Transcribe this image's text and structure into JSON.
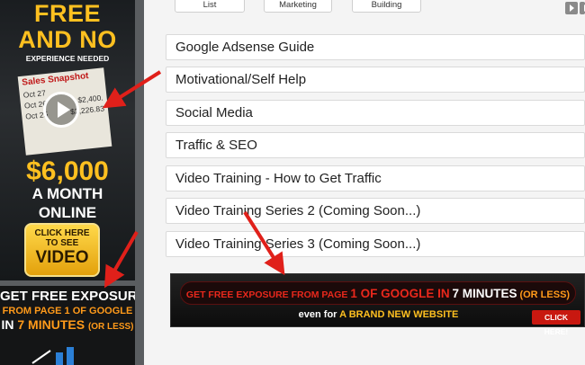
{
  "left_ad": {
    "free_line1": "FREE",
    "free_line2": "AND NO",
    "no_experience": "EXPERIENCE NEEDED",
    "sales_title": "Sales Snapshot",
    "sales_rows": [
      {
        "date": "Oct 27",
        "amount": ""
      },
      {
        "date": "Oct 26",
        "amount": "$2,400."
      },
      {
        "date": "Oct 25",
        "amount": "$2,226.83"
      }
    ],
    "money": "$6,000",
    "month": "A MONTH",
    "online": "ONLINE",
    "click_here": "CLICK HERE",
    "to_see": "TO SEE",
    "video": "VIDEO"
  },
  "left_ad2": {
    "line1": "GET FREE EXPOSURE",
    "line2": "FROM PAGE 1 OF GOOGLE",
    "in": "IN",
    "minutes": "7 MINUTES",
    "or_less": "(OR LESS)"
  },
  "top_buttons": [
    "List",
    "Marketing",
    "Building"
  ],
  "categories": [
    "Google Adsense Guide",
    "Motivational/Self Help",
    "Social Media",
    "Traffic & SEO",
    "Video Training - How to Get Traffic",
    "Video Training Series 2 (Coming Soon...)",
    "Video Training Series 3 (Coming Soon...)"
  ],
  "bottom_ad": {
    "pill_part1": "GET FREE EXPOSURE FROM PAGE",
    "pill_part2": "1 OF GOOGLE IN",
    "pill_part3": "7 MINUTES",
    "pill_part4": "(OR LESS)",
    "line2_part1": "even for",
    "line2_part2": "A BRAND NEW WEBSITE",
    "click": "CLICK HERE!"
  },
  "colors": {
    "annotation_arrow": "#e0201a",
    "accent_gold": "#ffc020",
    "accent_orange": "#ff9a1a"
  }
}
